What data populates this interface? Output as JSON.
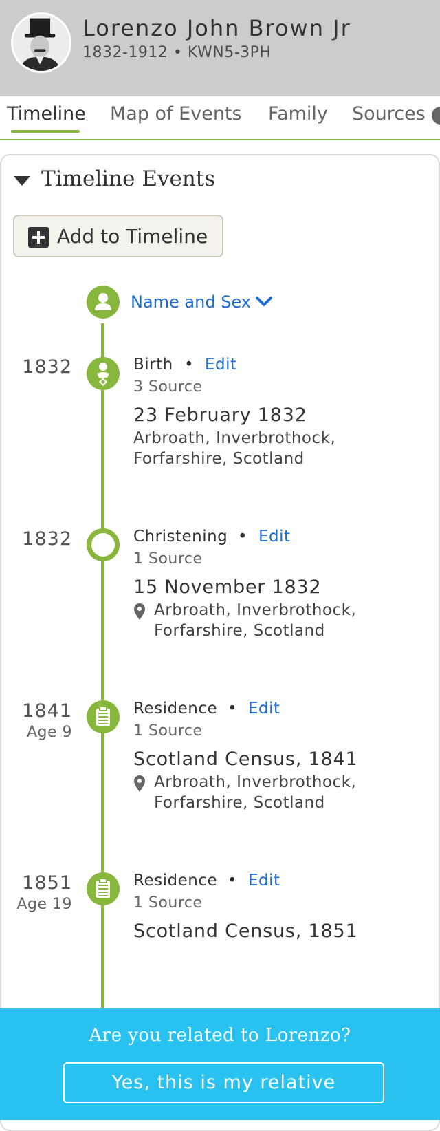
{
  "header": {
    "name": "Lorenzo John Brown Jr",
    "meta": "1832-1912 • KWN5-3PH"
  },
  "tabs": [
    {
      "label": "Timeline",
      "active": true
    },
    {
      "label": "Map of Events"
    },
    {
      "label": "Family"
    },
    {
      "label": "Sources"
    }
  ],
  "section": {
    "title": "Timeline Events",
    "add_label": "Add to Timeline"
  },
  "name_sex": {
    "label": "Name and Sex"
  },
  "events": [
    {
      "year": "1832",
      "age": "",
      "type": "Birth",
      "edit": "Edit",
      "sources": "3 Source",
      "main": "23 February 1832",
      "place_line1": "Arbroath, Inverbrothock,",
      "place_line2": "Forfarshire, Scotland",
      "icon": "baby-icon"
    },
    {
      "year": "1832",
      "age": "",
      "type": "Christening",
      "edit": "Edit",
      "sources": "1 Source",
      "main": "15 November 1832",
      "place_line1": "Arbroath, Inverbrothock,",
      "place_line2": "Forfarshire, Scotland",
      "icon": "ring-icon"
    },
    {
      "year": "1841",
      "age": "Age 9",
      "type": "Residence",
      "edit": "Edit",
      "sources": "1 Source",
      "main": "Scotland Census, 1841",
      "place_line1": "Arbroath, Inverbrothock,",
      "place_line2": "Forfarshire, Scotland",
      "icon": "clipboard-icon"
    },
    {
      "year": "1851",
      "age": "Age 19",
      "type": "Residence",
      "edit": "Edit",
      "sources": "1 Source",
      "main": "Scotland Census, 1851",
      "icon": "clipboard-icon"
    }
  ],
  "banner": {
    "question": "Are you related to Lorenzo?",
    "button": "Yes, this is my relative"
  },
  "colors": {
    "accent_green": "#87b73c",
    "link_blue": "#1b6bd3",
    "banner_blue": "#29c1ef",
    "header_gray": "#cccccc"
  }
}
